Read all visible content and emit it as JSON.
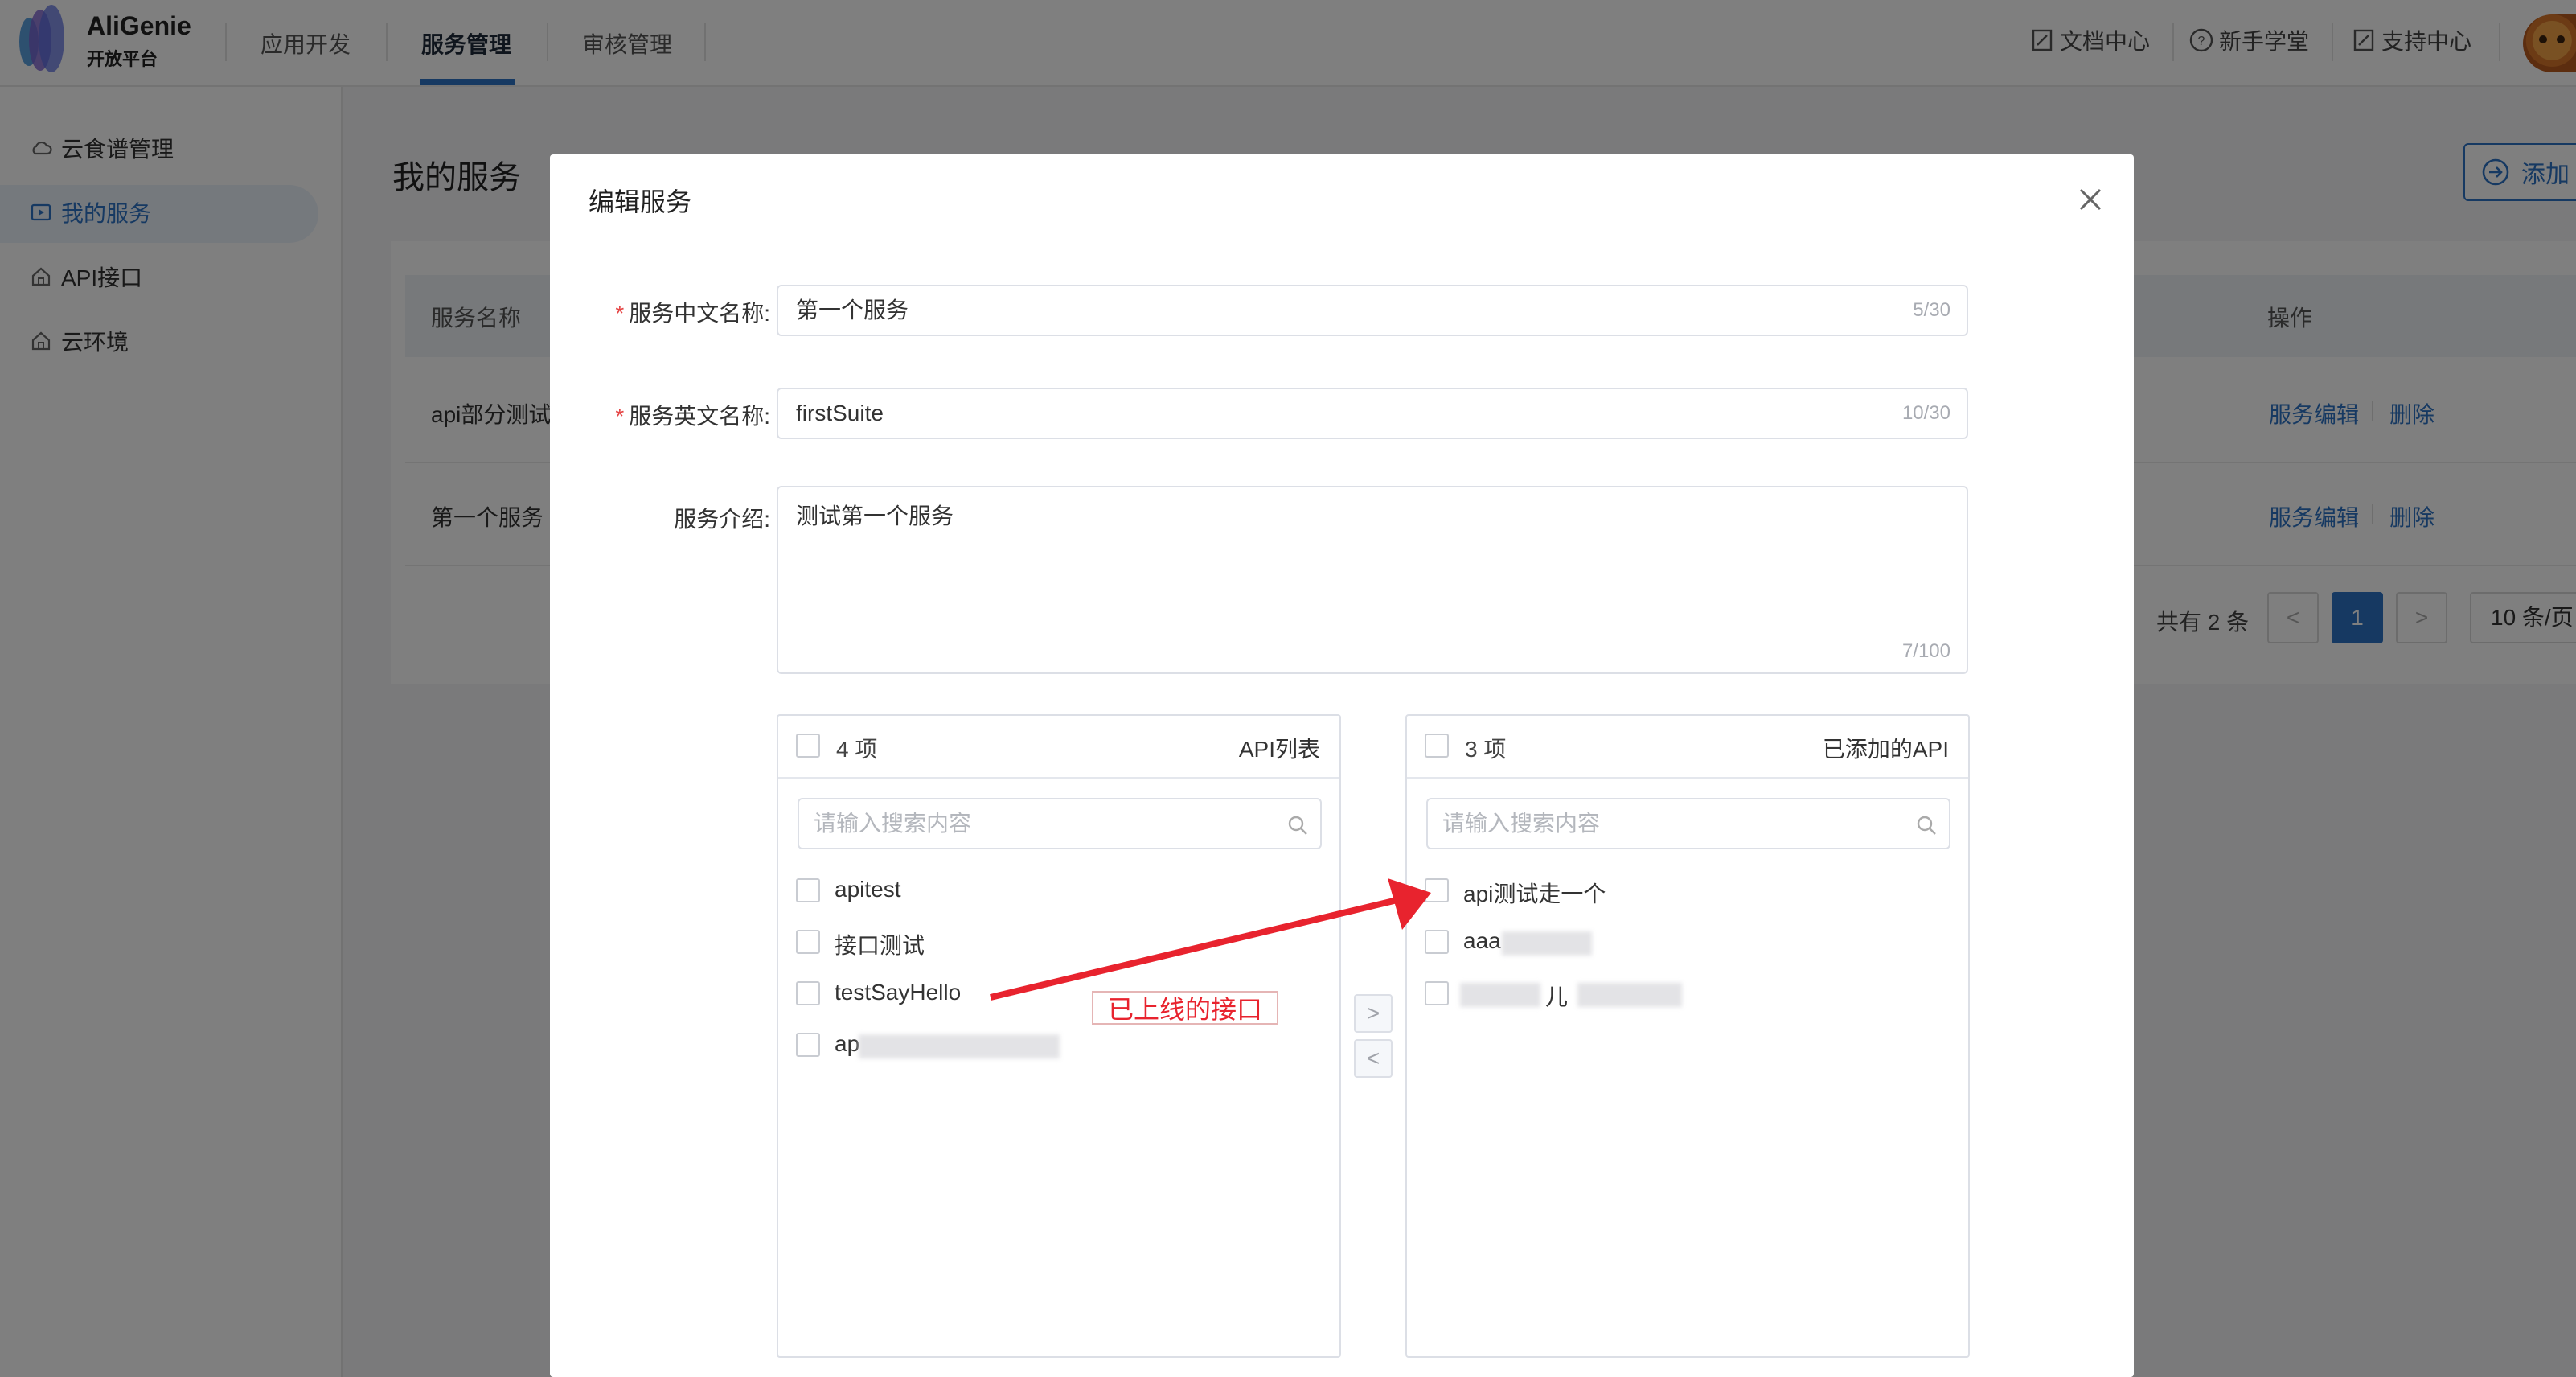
{
  "header": {
    "brand_name": "AliGenie",
    "brand_sub": "开放平台",
    "nav": [
      "应用开发",
      "服务管理",
      "审核管理"
    ],
    "active_nav": "服务管理",
    "links": [
      {
        "label": "文档中心",
        "icon": "doc-icon"
      },
      {
        "label": "新手学堂",
        "icon": "help-circle-icon"
      },
      {
        "label": "支持中心",
        "icon": "doc-icon"
      }
    ]
  },
  "sidebar": {
    "items": [
      {
        "label": "云食谱管理",
        "icon": "cloud-icon"
      },
      {
        "label": "我的服务",
        "icon": "play-box-icon",
        "active": true
      },
      {
        "label": "API接口",
        "icon": "home-icon"
      },
      {
        "label": "云环境",
        "icon": "home-icon"
      }
    ]
  },
  "main": {
    "title": "我的服务",
    "add_button": "添加",
    "columns": {
      "name": "服务名称",
      "ops": "操作"
    },
    "rows": [
      {
        "name": "api部分测试",
        "edit": "服务编辑",
        "delete": "删除"
      },
      {
        "name": "第一个服务",
        "edit": "服务编辑",
        "delete": "删除"
      }
    ],
    "pager": {
      "total": "共有 2 条",
      "prev": "<",
      "page": "1",
      "next": ">",
      "size": "10 条/页"
    }
  },
  "modal": {
    "title": "编辑服务",
    "cn_name_label": "服务中文名称:",
    "cn_name_value": "第一个服务",
    "cn_name_count": "5/30",
    "en_name_label": "服务英文名称:",
    "en_name_value": "firstSuite",
    "en_name_count": "10/30",
    "desc_label": "服务介绍:",
    "desc_value": "测试第一个服务",
    "desc_count": "7/100",
    "transfer": {
      "left": {
        "count": "4 项",
        "title": "API列表",
        "placeholder": "请输入搜索内容",
        "items": [
          "apitest",
          "接口测试",
          "testSayHello",
          "ap"
        ]
      },
      "right": {
        "count": "3 项",
        "title": "已添加的API",
        "placeholder": "请输入搜索内容",
        "items": [
          "api测试走一个",
          "aaa",
          "儿"
        ]
      },
      "to_right": ">",
      "to_left": "<"
    }
  },
  "annotation": {
    "label": "已上线的接口",
    "color": "#e8232e"
  },
  "colors": {
    "accent": "#2d72c4",
    "required": "#e54545"
  }
}
